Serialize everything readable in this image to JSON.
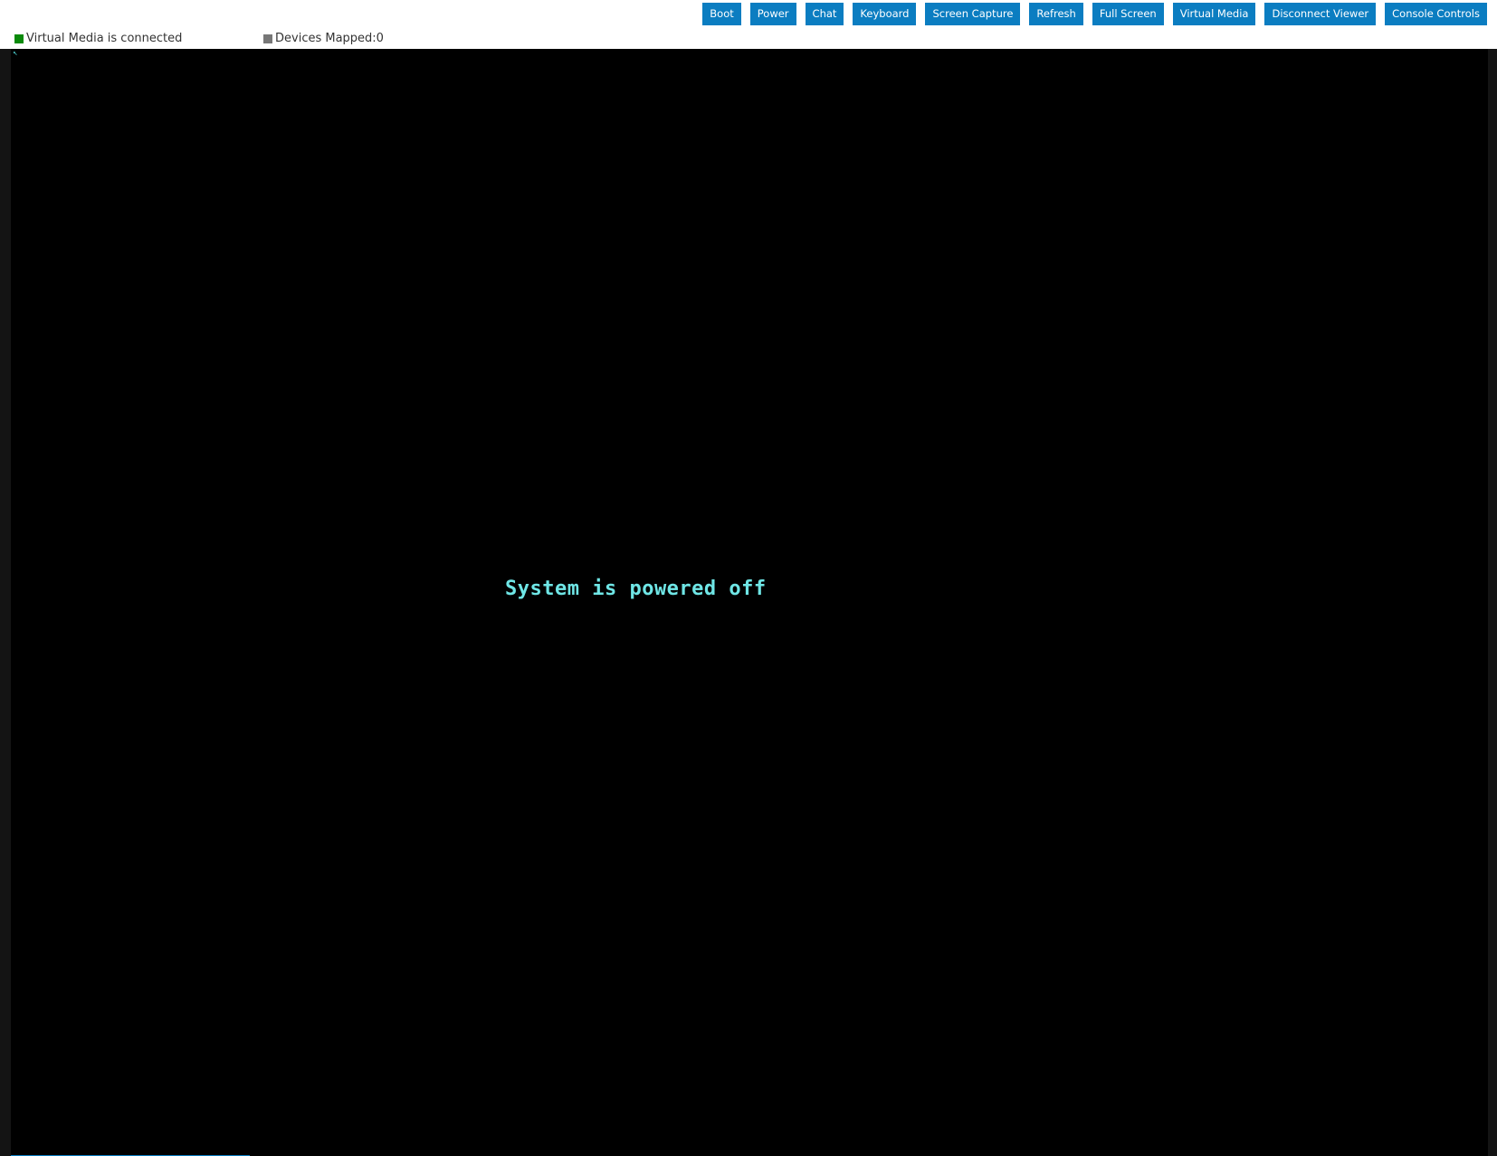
{
  "toolbar": {
    "buttons": [
      {
        "label": "Boot"
      },
      {
        "label": "Power"
      },
      {
        "label": "Chat"
      },
      {
        "label": "Keyboard"
      },
      {
        "label": "Screen Capture"
      },
      {
        "label": "Refresh"
      },
      {
        "label": "Full Screen"
      },
      {
        "label": "Virtual Media"
      },
      {
        "label": "Disconnect Viewer"
      },
      {
        "label": "Console Controls"
      }
    ]
  },
  "status": {
    "virtual_media": {
      "text": "Virtual Media is connected",
      "color": "#0a8a0a"
    },
    "devices_mapped": {
      "text": "Devices Mapped:0",
      "color": "#777777"
    }
  },
  "console": {
    "message": "System is powered off",
    "message_color": "#6fe6e6",
    "background": "#000000"
  },
  "colors": {
    "button_bg": "#0b7dc1"
  }
}
